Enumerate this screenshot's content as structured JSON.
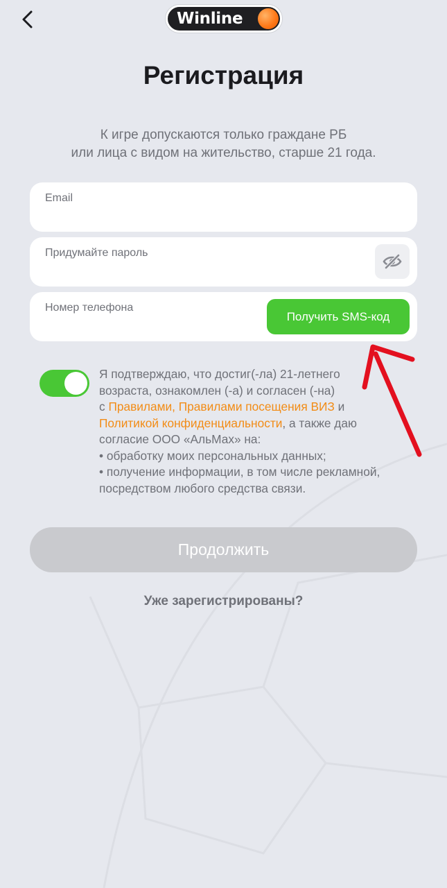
{
  "header": {
    "back_icon": "chevron-left-icon",
    "logo_text": "Winline",
    "logo_ball_icon": "orange-ball-icon"
  },
  "page": {
    "title": "Регистрация",
    "subtitle_line1": "К игре допускаются только граждане РБ",
    "subtitle_line2": "или лица с видом на жительство, старше 21 года."
  },
  "form": {
    "email_label": "Email",
    "email_value": "",
    "password_label": "Придумайте пароль",
    "password_value": "",
    "password_toggle_icon": "eye-slash-icon",
    "phone_label": "Номер телефона",
    "phone_value": "",
    "sms_button_label": "Получить SMS-код"
  },
  "annotation": {
    "arrow_icon": "red-arrow-icon",
    "color": "#e3101f"
  },
  "consent": {
    "toggle_on": true,
    "line1": "Я подтверждаю, что достиг(-ла) 21-летнего",
    "line2": "возраста, ознакомлен (-а) и согласен (-на)",
    "line3_prefix": "с ",
    "rules_link": "Правилами, Правилами посещения ВИЗ",
    "line3_suffix": " и",
    "privacy_link": "Политикой конфиденциальности",
    "line4_suffix": ",  а также даю",
    "line5": "согласие ООО «АльМах» на:",
    "line6": " • обработку моих персональных данных;",
    "line7": " • получение информации, в том числе рекламной,",
    "line8": "посредством любого средства связи."
  },
  "actions": {
    "continue_label": "Продолжить",
    "login_label": "Уже зарегистрированы?"
  },
  "colors": {
    "accent_green": "#49c735",
    "link_orange": "#f28c16",
    "disabled_button": "#c9cace",
    "background": "#e6e8ee"
  }
}
